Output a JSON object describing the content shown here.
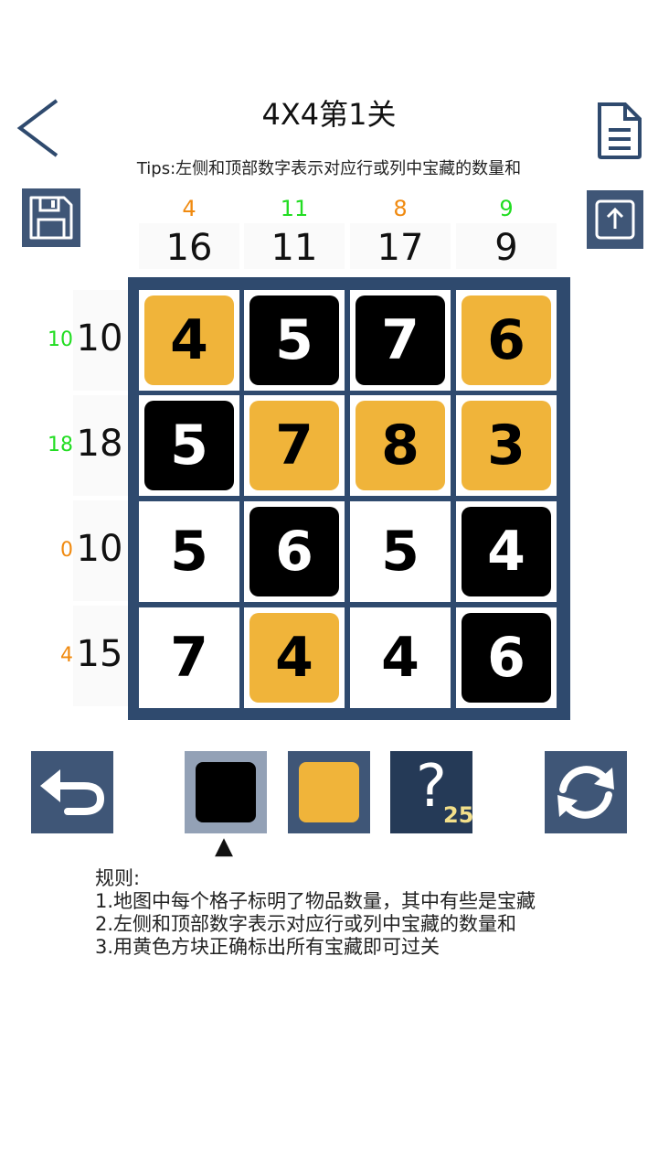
{
  "header": {
    "title": "4X4第1关",
    "tips": "Tips:左侧和顶部数字表示对应行或列中宝藏的数量和"
  },
  "icons": {
    "back": "chevron-left-icon",
    "document": "document-icon",
    "save": "save-icon",
    "share": "share-upload-icon",
    "undo": "undo-icon",
    "restart": "refresh-icon"
  },
  "colors": {
    "treasure": "#f0b43a",
    "blocked": "#000000",
    "board": "#2f4a6e",
    "button": "#3f5677",
    "clue_ok": "#22dd22",
    "clue_current": "#f08a10"
  },
  "columns": [
    {
      "current": "4",
      "target": "16",
      "status": "current"
    },
    {
      "current": "11",
      "target": "11",
      "status": "ok"
    },
    {
      "current": "8",
      "target": "17",
      "status": "current"
    },
    {
      "current": "9",
      "target": "9",
      "status": "ok"
    }
  ],
  "rows": [
    {
      "current": "10",
      "target": "10",
      "status": "ok"
    },
    {
      "current": "18",
      "target": "18",
      "status": "ok"
    },
    {
      "current": "0",
      "target": "10",
      "status": "current"
    },
    {
      "current": "4",
      "target": "15",
      "status": "current"
    }
  ],
  "grid": [
    [
      {
        "v": "4",
        "s": "yellow"
      },
      {
        "v": "5",
        "s": "black"
      },
      {
        "v": "7",
        "s": "black"
      },
      {
        "v": "6",
        "s": "yellow"
      }
    ],
    [
      {
        "v": "5",
        "s": "black"
      },
      {
        "v": "7",
        "s": "yellow"
      },
      {
        "v": "8",
        "s": "yellow"
      },
      {
        "v": "3",
        "s": "yellow"
      }
    ],
    [
      {
        "v": "5",
        "s": "empty"
      },
      {
        "v": "6",
        "s": "black"
      },
      {
        "v": "5",
        "s": "empty"
      },
      {
        "v": "4",
        "s": "black"
      }
    ],
    [
      {
        "v": "7",
        "s": "empty"
      },
      {
        "v": "4",
        "s": "yellow"
      },
      {
        "v": "4",
        "s": "empty"
      },
      {
        "v": "6",
        "s": "black"
      }
    ]
  ],
  "toolbar": {
    "hint_symbol": "?",
    "hint_count": "25",
    "selected_tool": "black",
    "pointer": "▲"
  },
  "rules": {
    "heading": "规则:",
    "lines": [
      "1.地图中每个格子标明了物品数量，其中有些是宝藏",
      "2.左侧和顶部数字表示对应行或列中宝藏的数量和",
      "3.用黄色方块正确标出所有宝藏即可过关"
    ]
  }
}
